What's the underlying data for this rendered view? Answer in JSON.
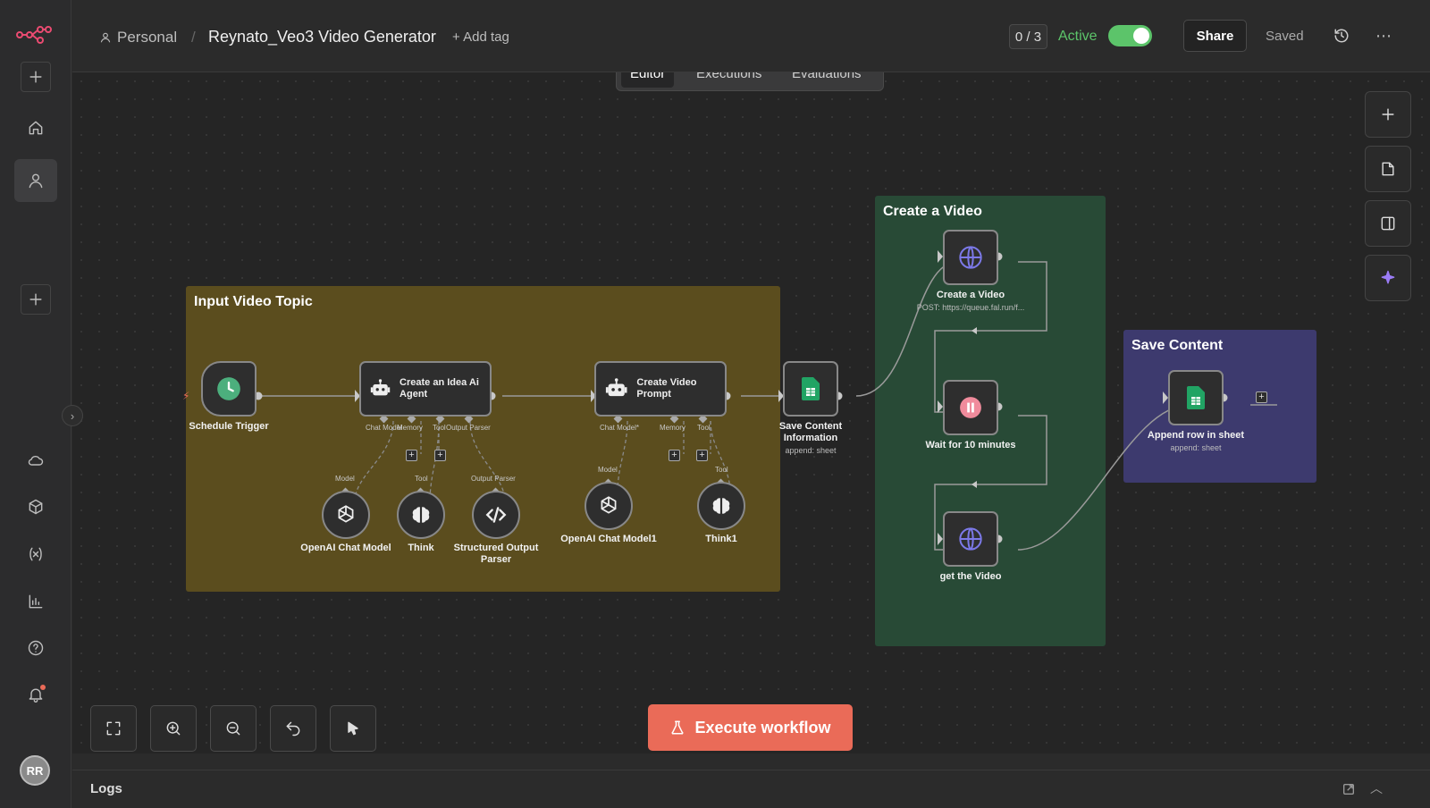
{
  "header": {
    "project": "Personal",
    "workflow_name": "Reynato_Veo3 Video Generator",
    "add_tag": "+ Add tag",
    "counter": "0 / 3",
    "status_label": "Active",
    "active": true,
    "share_label": "Share",
    "saved_label": "Saved"
  },
  "tabs": [
    {
      "label": "Editor",
      "active": true
    },
    {
      "label": "Executions",
      "active": false
    },
    {
      "label": "Evaluations",
      "active": false
    }
  ],
  "sidebar": {
    "avatar_initials": "RR",
    "items": [
      "add",
      "home",
      "personal",
      "add-project",
      "cloud",
      "templates",
      "variables",
      "insights",
      "help",
      "notifications"
    ]
  },
  "groups": {
    "input": {
      "title": "Input Video Topic",
      "color": "#5b4d1e"
    },
    "create": {
      "title": "Create a Video",
      "color": "#284a36"
    },
    "save": {
      "title": "Save Content",
      "color": "#3d3a6e"
    }
  },
  "nodes": {
    "schedule": {
      "label": "Schedule Trigger",
      "icon": "clock-icon"
    },
    "idea_agent": {
      "label": "Create an Idea Ai Agent",
      "icon": "robot-icon"
    },
    "video_prompt": {
      "label": "Create Video Prompt",
      "icon": "robot-icon"
    },
    "save_info": {
      "label": "Save Content Information",
      "sub": "append: sheet",
      "icon": "sheets-icon"
    },
    "create_video": {
      "label": "Create a Video",
      "sub": "POST: https://queue.fal.run/f...",
      "icon": "globe-icon"
    },
    "wait": {
      "label": "Wait for 10 minutes",
      "icon": "pause-icon"
    },
    "get_video": {
      "label": "get the Video",
      "icon": "globe-icon"
    },
    "append_row": {
      "label": "Append row in sheet",
      "sub": "append: sheet",
      "icon": "sheets-icon"
    },
    "openai1": {
      "label": "OpenAI Chat Model",
      "port": "Model",
      "icon": "openai-icon"
    },
    "think": {
      "label": "Think",
      "port": "Tool",
      "icon": "brain-icon"
    },
    "parser": {
      "label": "Structured Output Parser",
      "port": "Output Parser",
      "icon": "code-icon"
    },
    "openai2": {
      "label": "OpenAI Chat Model1",
      "port": "Model",
      "icon": "openai-icon"
    },
    "think2": {
      "label": "Think1",
      "port": "Tool",
      "icon": "brain-icon"
    }
  },
  "ports": {
    "agent1": [
      "Chat Model",
      "Memory",
      "Tool",
      "Output Parser"
    ],
    "agent2": [
      "Chat Model*",
      "Memory",
      "Tool"
    ]
  },
  "execute_label": "Execute workflow",
  "logs_label": "Logs",
  "colors": {
    "accent": "#ea6b58",
    "active_green": "#5cc46a",
    "brand": "#ea4b71"
  }
}
